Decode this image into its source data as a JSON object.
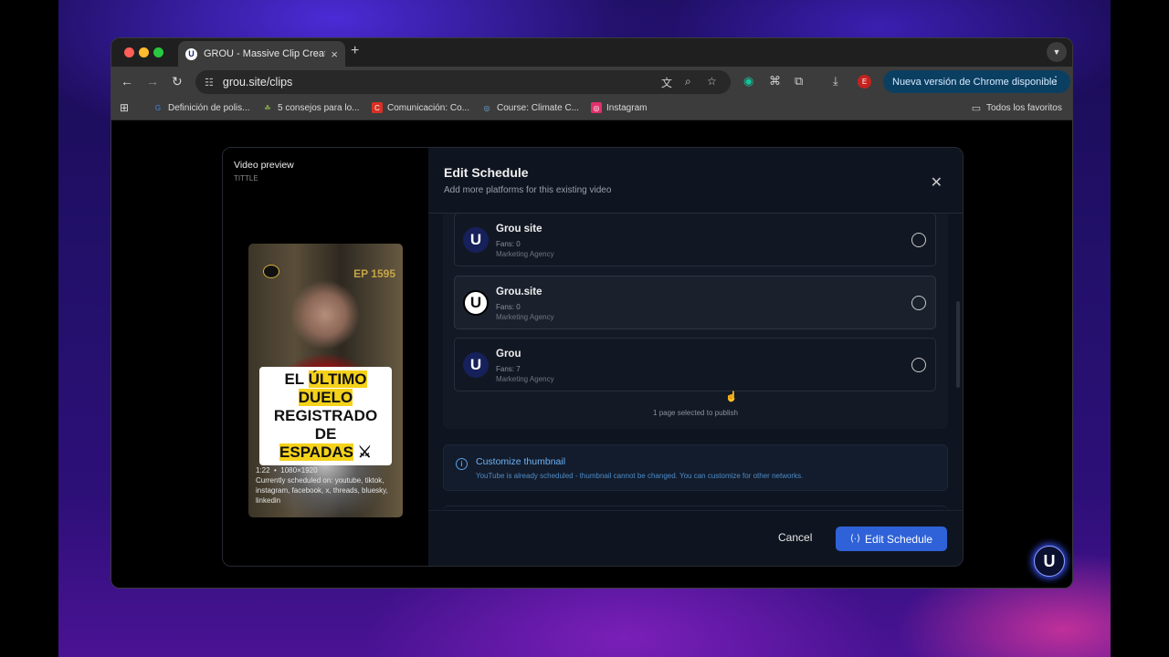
{
  "browser": {
    "tab_title": "GROU - Massive Clip Creation",
    "url": "grou.site/clips",
    "update_button": "Nueva versión de Chrome disponible",
    "profile_initial": "E",
    "bookmarks": [
      {
        "label": "Definición de polis...",
        "icon": "G",
        "color": "#4285f4"
      },
      {
        "label": "5 consejos para lo...",
        "icon": "☘",
        "color": "#8ab04a"
      },
      {
        "label": "Comunicación: Co...",
        "icon": "C",
        "color": "#d93025"
      },
      {
        "label": "Course: Climate C...",
        "icon": "◎",
        "color": "#3a6ea5"
      },
      {
        "label": "Instagram",
        "icon": "◎",
        "color": "#e1306c"
      }
    ],
    "all_bookmarks": "Todos los favoritos"
  },
  "preview": {
    "heading": "Video preview",
    "subtitle": "TITTLE",
    "episode": "EP 1595",
    "caption_line1_a": "EL ",
    "caption_line1_b": "ÚLTIMO DUELO",
    "caption_line2": "REGISTRADO DE",
    "caption_line3_a": "ESPADAS",
    "caption_line3_b": " ⚔",
    "duration": "1:22",
    "resolution": "1080×1920",
    "scheduled_text": "Currently scheduled on: youtube, tiktok, instagram, facebook, x, threads, bluesky, linkedin"
  },
  "modal": {
    "title": "Edit Schedule",
    "subtitle": "Add more platforms for this existing video",
    "pages": [
      {
        "name": "Grou site",
        "fans": "Fans: 0",
        "category": "Marketing Agency"
      },
      {
        "name": "Grou.site",
        "fans": "Fans: 0",
        "category": "Marketing Agency"
      },
      {
        "name": "Grou",
        "fans": "Fans: 7",
        "category": "Marketing Agency"
      }
    ],
    "selected_note": "1 page selected to publish",
    "thumbnail": {
      "title": "Customize thumbnail",
      "description": "YouTube is already scheduled - thumbnail cannot be changed. You can customize for other networks."
    },
    "cancel_label": "Cancel",
    "submit_label": "Edit Schedule"
  },
  "icons": {
    "logo_glyph": "U",
    "close": "✕"
  }
}
